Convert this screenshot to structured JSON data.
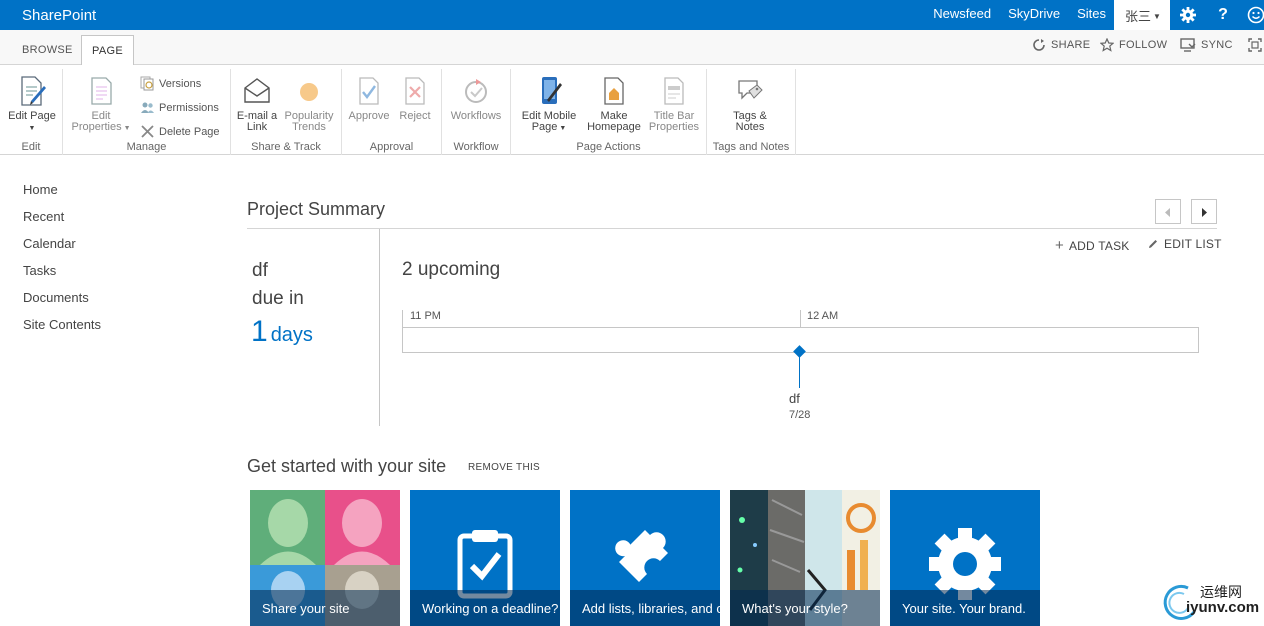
{
  "suite_bar": {
    "brand": "SharePoint",
    "links": [
      "Newsfeed",
      "SkyDrive",
      "Sites"
    ],
    "user": "张三",
    "accent": "#0072c6"
  },
  "ribbon_tabs": {
    "browse": "BROWSE",
    "page": "PAGE",
    "share": "SHARE",
    "follow": "FOLLOW",
    "sync": "SYNC"
  },
  "ribbon": {
    "edit_group": {
      "label": "Edit",
      "edit_page": "Edit Page"
    },
    "manage_group": {
      "label": "Manage",
      "edit_properties_line1": "Edit",
      "edit_properties_line2": "Properties",
      "versions": "Versions",
      "permissions": "Permissions",
      "delete_page": "Delete Page"
    },
    "share_group": {
      "label": "Share & Track",
      "email_line1": "E-mail a",
      "email_line2": "Link",
      "popularity_line1": "Popularity",
      "popularity_line2": "Trends"
    },
    "approval_group": {
      "label": "Approval",
      "approve": "Approve",
      "reject": "Reject"
    },
    "workflow_group": {
      "label": "Workflow",
      "workflows": "Workflows"
    },
    "page_actions_group": {
      "label": "Page Actions",
      "edit_mobile_line1": "Edit Mobile",
      "edit_mobile_line2": "Page",
      "make_home_line1": "Make",
      "make_home_line2": "Homepage",
      "title_bar_line1": "Title Bar",
      "title_bar_line2": "Properties"
    },
    "tags_group": {
      "label": "Tags and Notes",
      "tags_line1": "Tags &",
      "tags_line2": "Notes"
    }
  },
  "left_nav": [
    "Home",
    "Recent",
    "Calendar",
    "Tasks",
    "Documents",
    "Site Contents"
  ],
  "project_summary": {
    "title": "Project Summary",
    "task_name": "df",
    "due_in": "due in",
    "days_count": "1",
    "days_unit": "days",
    "upcoming": "2 upcoming",
    "add_task": "ADD TASK",
    "edit_list": "EDIT LIST",
    "timeline": {
      "start_label": "11 PM",
      "mid_label": "12 AM",
      "task_label": "df",
      "task_date": "7/28"
    }
  },
  "get_started": {
    "title": "Get started with your site",
    "remove": "REMOVE THIS",
    "tiles": [
      {
        "caption": "Share your site"
      },
      {
        "caption": "Working on a deadline?"
      },
      {
        "caption": "Add lists, libraries, and other apps"
      },
      {
        "caption": "What's your style?"
      },
      {
        "caption": "Your site. Your brand."
      }
    ]
  },
  "watermark": {
    "cn": "运维网",
    "en": "iyunv.com"
  }
}
